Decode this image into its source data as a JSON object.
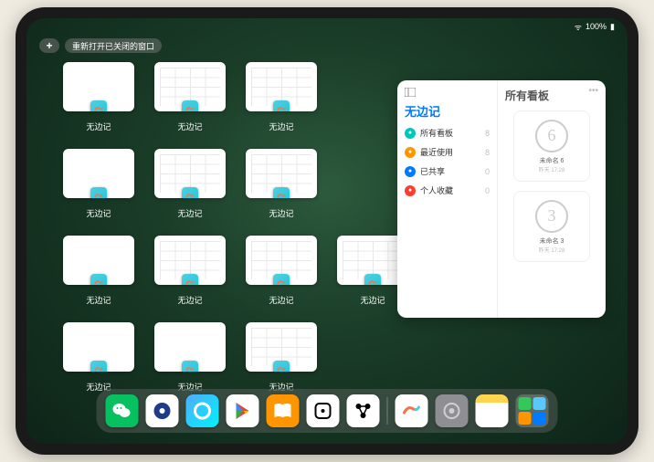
{
  "status": {
    "battery": "100%",
    "signal": "📶"
  },
  "topbar": {
    "plus": "+",
    "reopen_label": "重新打开已关闭的窗口"
  },
  "app_switcher": {
    "app_name": "无边记",
    "windows": [
      {
        "style": "blank"
      },
      {
        "style": "grid"
      },
      {
        "style": "grid"
      },
      {
        "style": "blank"
      },
      {
        "style": "grid"
      },
      {
        "style": "grid"
      },
      {
        "style": "blank"
      },
      {
        "style": "grid"
      },
      {
        "style": "grid"
      },
      {
        "style": "grid"
      },
      {
        "style": "blank"
      },
      {
        "style": "blank"
      },
      {
        "style": "grid"
      }
    ]
  },
  "panel": {
    "app_title": "无边记",
    "sections": [
      {
        "icon": "grid",
        "color": "#00c7be",
        "label": "所有看板",
        "count": "8"
      },
      {
        "icon": "clock",
        "color": "#ff9500",
        "label": "最近使用",
        "count": "8"
      },
      {
        "icon": "people",
        "color": "#007aff",
        "label": "已共享",
        "count": "0"
      },
      {
        "icon": "heart",
        "color": "#ff3b30",
        "label": "个人收藏",
        "count": "0"
      }
    ],
    "right_title": "所有看板",
    "boards": [
      {
        "sketch": "6",
        "name": "未命名 6",
        "time": "昨天 17:28"
      },
      {
        "sketch": "3",
        "name": "未命名 3",
        "time": "昨天 17:28"
      }
    ]
  },
  "dock": {
    "apps": [
      "wechat",
      "quark",
      "qbrowser",
      "play",
      "books",
      "dice",
      "connect",
      "freeform",
      "settings",
      "notes"
    ]
  }
}
